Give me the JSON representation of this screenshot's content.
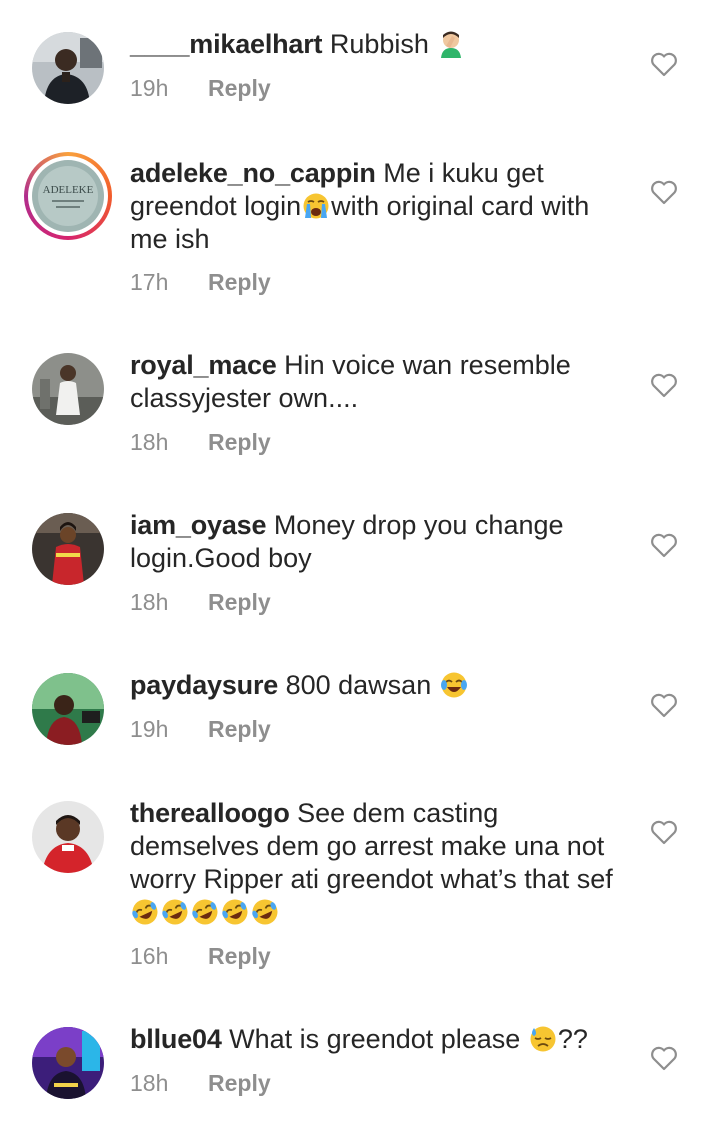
{
  "comments": [
    {
      "username": "____mikaelhart",
      "text": " Rubbish ",
      "emoji_after": "facepalm",
      "time": "19h",
      "reply_label": "Reply",
      "avatar_icon": "avatar-man-dark-suit"
    },
    {
      "username": "adeleke_no_cappin",
      "text_1": " Me i kuku get greendot login",
      "emoji_mid": "crying-face",
      "text_2": "with original card with me ish",
      "time": "17h",
      "reply_label": "Reply",
      "avatar_label": "ADELEKE",
      "avatar_icon": "avatar-story-ring"
    },
    {
      "username": "royal_mace",
      "text": " Hin voice wan resemble classyjester own....",
      "time": "18h",
      "reply_label": "Reply",
      "avatar_icon": "avatar-man-white-outfit"
    },
    {
      "username": "iam_oyase",
      "text": " Money drop you change login.Good boy",
      "time": "18h",
      "reply_label": "Reply",
      "avatar_icon": "avatar-woman-red-dress"
    },
    {
      "username": "paydaysure",
      "text": " 800 dawsan ",
      "emoji_after": "tears-of-joy",
      "time": "19h",
      "reply_label": "Reply",
      "avatar_icon": "avatar-person-green"
    },
    {
      "username": "therealloogo",
      "text": " See dem casting demselves dem go arrest make una not worry Ripper ati greendot what’s that sef ",
      "emoji_count": 5,
      "emoji_repeat": "rolling-laughing",
      "time": "16h",
      "reply_label": "Reply",
      "avatar_icon": "avatar-man-red-top"
    },
    {
      "username": "bllue04",
      "text": " What is greendot  please ",
      "emoji_after": "downcast-sweat",
      "text_tail": "??",
      "time": "18h",
      "reply_label": "Reply",
      "avatar_icon": "avatar-person-purple"
    }
  ],
  "colors": {
    "text": "#262626",
    "muted": "#8e8e8e",
    "heart_outline": "#8e8e8e"
  }
}
